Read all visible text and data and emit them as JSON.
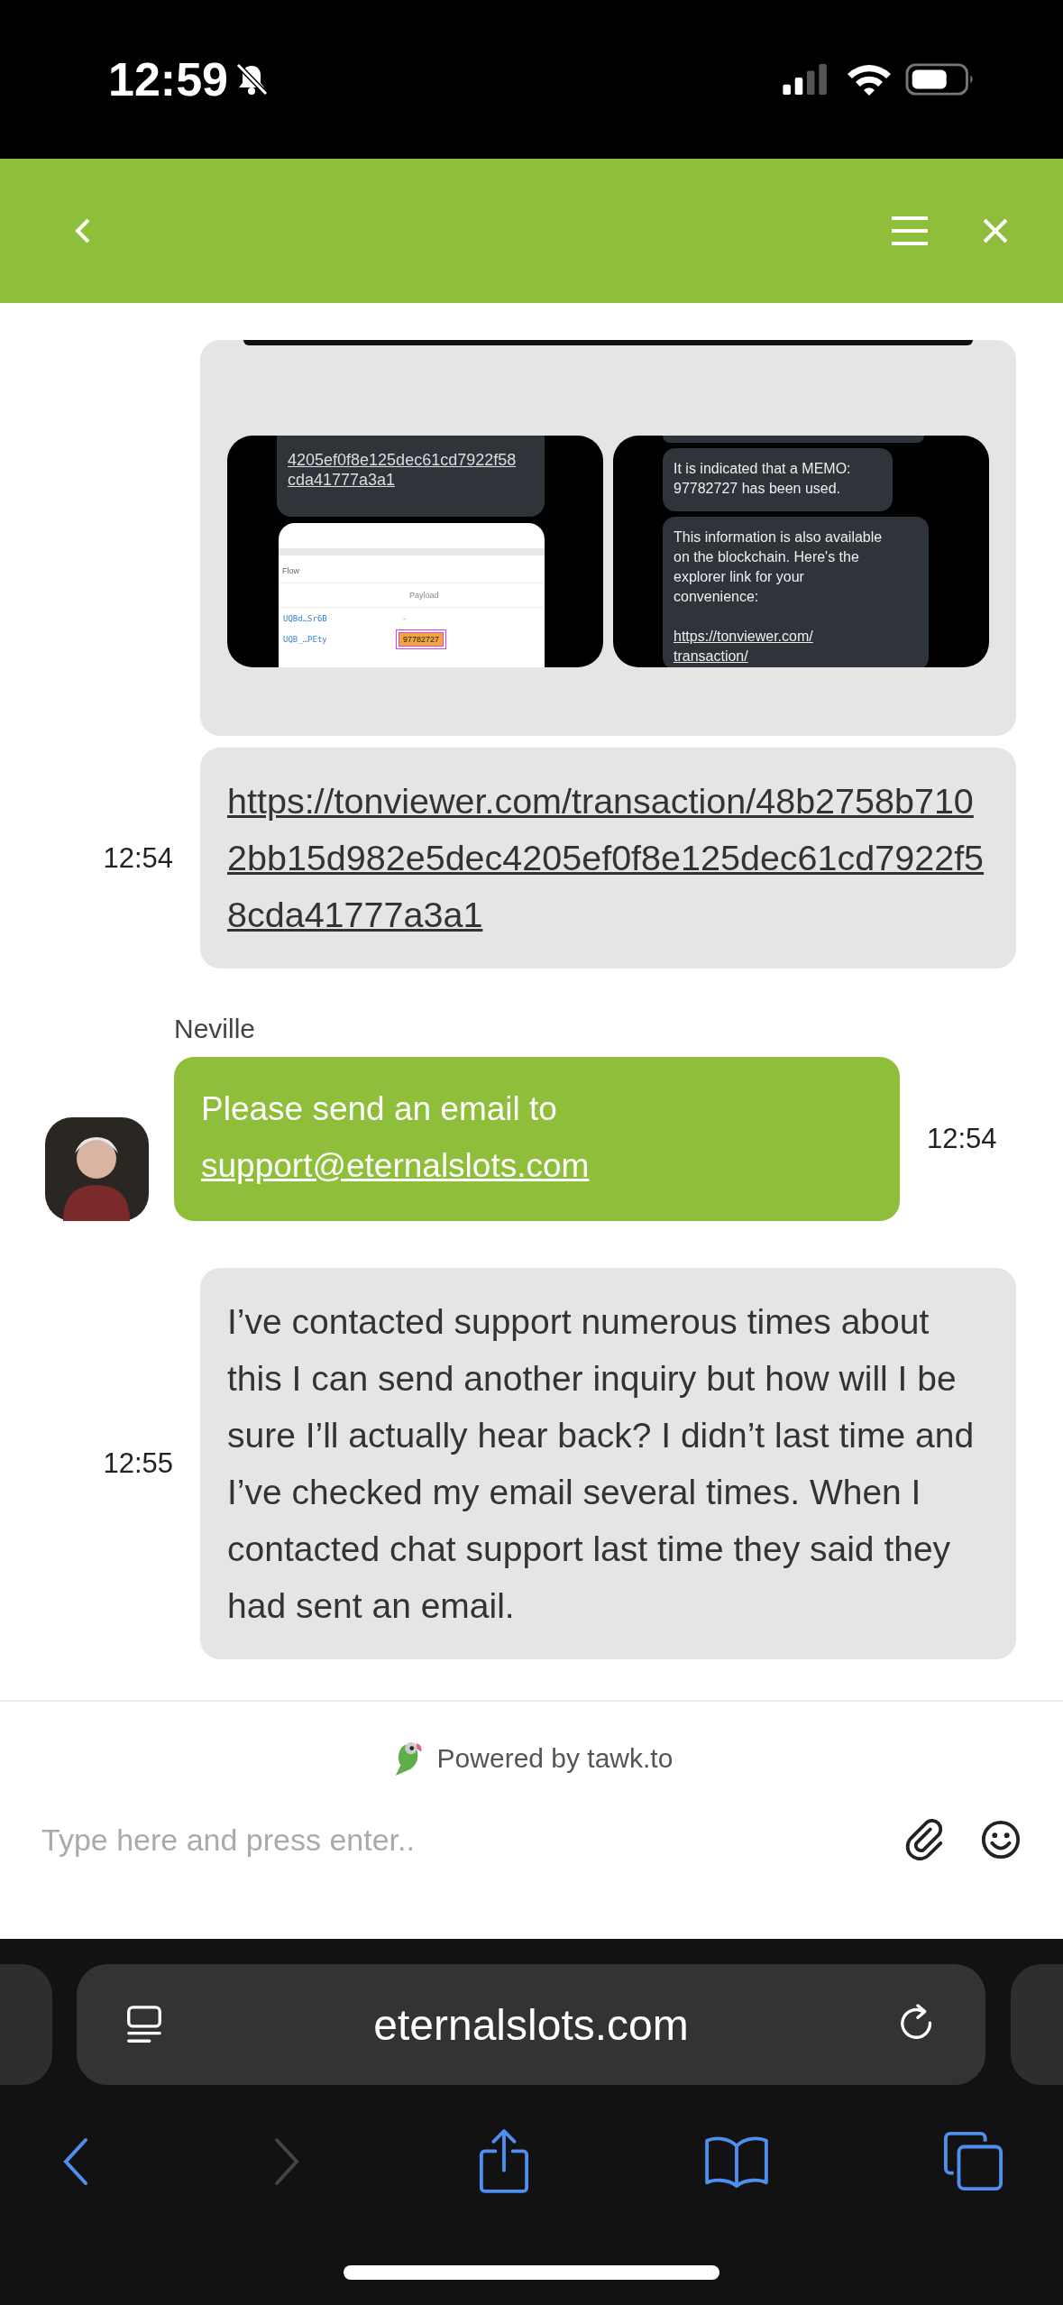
{
  "status_bar": {
    "time": "12:59"
  },
  "messages": [
    {
      "kind": "attachments",
      "thumbnails": [
        {
          "kind": "link_screenshot",
          "link_lines": [
            "4205ef0f8e125dec61cd7922f58",
            "cda41777a3a1"
          ],
          "table": {
            "header_1": "Flow",
            "header_2": "Payload",
            "rows": [
              {
                "address": "UQBd…Sr6B",
                "payload": "-",
                "highlighted": false
              },
              {
                "address": "UQB_…PEty",
                "payload": "97782727",
                "highlighted": true
              }
            ]
          }
        },
        {
          "kind": "message_screenshot",
          "bubbles": [
            {
              "lines": [
                "It is indicated that a MEMO:",
                "97782727 has been used."
              ]
            },
            {
              "lines": [
                "This information is also available",
                "on the blockchain. Here's the",
                "explorer link for your",
                "convenience:"
              ],
              "link_lines": [
                "https://tonviewer.com/",
                "transaction/"
              ]
            }
          ]
        }
      ]
    },
    {
      "kind": "visitor_link",
      "time": "12:54",
      "text": "https://tonviewer.com/transaction/48b2758b7102bb15d982e5dec4205ef0f8e125dec61cd7922f58cda41777a3a1"
    },
    {
      "kind": "agent",
      "author": "Neville",
      "time": "12:54",
      "text": "Please send an email to",
      "link": "support@eternalslots.com"
    },
    {
      "kind": "visitor",
      "time": "12:55",
      "text": "I’ve contacted support numerous times about this I can send another inquiry but how will I be sure I’ll actually hear back? I didn’t last time and I’ve checked my email several times. When I contacted chat support last time they said they had sent an email."
    }
  ],
  "powered_by": "Powered by tawk.to",
  "composer": {
    "placeholder": "Type here and press enter.."
  },
  "browser": {
    "url": "eternalslots.com",
    "nav": [
      {
        "kind": "back",
        "disabled": false
      },
      {
        "kind": "forward",
        "disabled": true
      },
      {
        "kind": "share",
        "disabled": false
      },
      {
        "kind": "bookmarks",
        "disabled": false
      },
      {
        "kind": "tabs",
        "disabled": false
      }
    ]
  }
}
